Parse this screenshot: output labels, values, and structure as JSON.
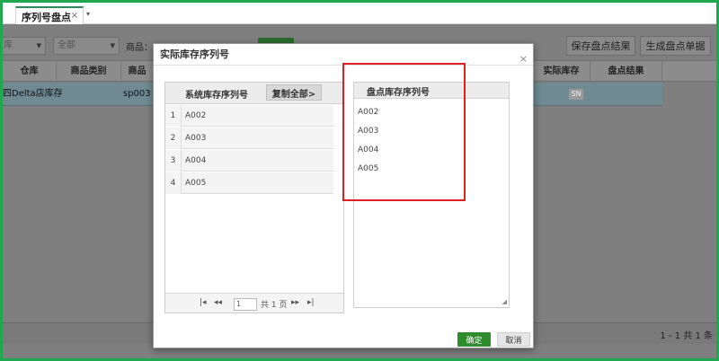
{
  "tabs": [
    {
      "label": "序列号盘点",
      "close": "×"
    }
  ],
  "tab_more": "▾",
  "toolbar": {
    "select1": "库",
    "select2": "全部",
    "product_label": "商品：",
    "save_button": "保存盘点结果",
    "generate_button": "生成盘点单据"
  },
  "table": {
    "headers": [
      "仓库",
      "商品类别",
      "商品",
      "实际库存",
      "盘点结果"
    ],
    "row": {
      "warehouse": "四Delta店库存",
      "product": "sp003",
      "badge": "SN"
    }
  },
  "footer": {
    "pager": "1 - 1   共 1 条"
  },
  "modal": {
    "title": "实际库存序列号",
    "close": "×",
    "left": {
      "header": "系统库存序列号",
      "copy_all": "复制全部>",
      "rows": [
        {
          "num": "1",
          "value": "A002"
        },
        {
          "num": "2",
          "value": "A003"
        },
        {
          "num": "3",
          "value": "A004"
        },
        {
          "num": "4",
          "value": "A005"
        }
      ],
      "pager": {
        "first": "|◂",
        "prev": "◂◂",
        "page": "1",
        "total": "共 1 页",
        "next": "▸▸",
        "last": "▸|"
      }
    },
    "right": {
      "header": "盘点库存序列号",
      "items": [
        "A002",
        "A003",
        "A004",
        "A005"
      ]
    },
    "ok": "确定",
    "cancel": "取消"
  }
}
